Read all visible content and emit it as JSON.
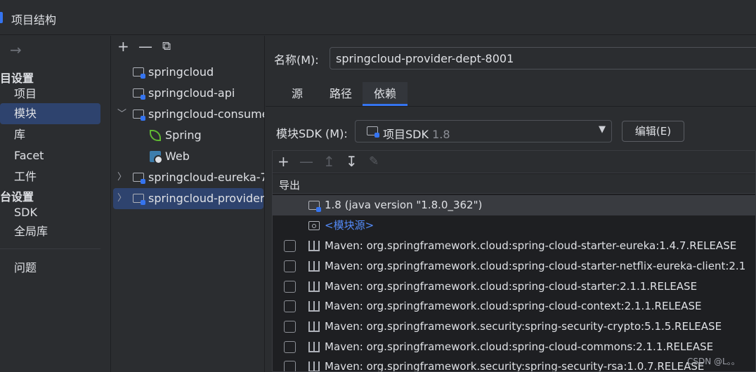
{
  "window": {
    "title": "项目结构"
  },
  "nav": {
    "back_arrow": "→",
    "project_settings_label": "目设置",
    "platform_settings_label": "台设置",
    "items_project": [
      "项目",
      "模块",
      "库",
      "Facet",
      "工件"
    ],
    "items_platform": [
      "SDK",
      "全局库"
    ],
    "problems_label": "问题",
    "selected": "模块"
  },
  "module_tree": {
    "toolbar": {
      "add": "+",
      "remove": "—",
      "copy": "⧉"
    },
    "rows": [
      {
        "label": "springcloud",
        "expandable": false
      },
      {
        "label": "springcloud-api",
        "expandable": false
      },
      {
        "label": "springcloud-consume",
        "expandable": true,
        "expanded": true
      },
      {
        "label": "Spring",
        "kind": "spring"
      },
      {
        "label": "Web",
        "kind": "web"
      },
      {
        "label": "springcloud-eureka-7",
        "expandable": true,
        "expanded": false
      },
      {
        "label": "springcloud-provider-",
        "expandable": true,
        "expanded": false,
        "selected": true
      }
    ]
  },
  "main": {
    "name_label": "名称(M):",
    "name_value": "springcloud-provider-dept-8001",
    "tabs": [
      "源",
      "路径",
      "依赖"
    ],
    "active_tab": "依赖",
    "sdk_label": "模块SDK (M):",
    "sdk_value": "项目SDK",
    "sdk_version": "1.8",
    "edit_button": "编辑(E)"
  },
  "dependencies": {
    "toolbar": {
      "add": "+",
      "remove": "—",
      "up": "↥",
      "down": "↧",
      "edit": "✎"
    },
    "header_export": "导出",
    "jdk_row": "1.8 (java version \"1.8.0_362\")",
    "module_source_row": "<模块源>",
    "maven_rows": [
      "Maven: org.springframework.cloud:spring-cloud-starter-eureka:1.4.7.RELEASE",
      "Maven: org.springframework.cloud:spring-cloud-starter-netflix-eureka-client:2.1",
      "Maven: org.springframework.cloud:spring-cloud-starter:2.1.1.RELEASE",
      "Maven: org.springframework.cloud:spring-cloud-context:2.1.1.RELEASE",
      "Maven: org.springframework.security:spring-security-crypto:5.1.5.RELEASE",
      "Maven: org.springframework.cloud:spring-cloud-commons:2.1.1.RELEASE",
      "Maven: org.springframework.security:spring-security-rsa:1.0.7.RELEASE"
    ]
  },
  "watermark": "CSDN @L。。",
  "colors": {
    "accent": "#3574f0",
    "selection": "#2e436e",
    "link": "#548af7"
  }
}
